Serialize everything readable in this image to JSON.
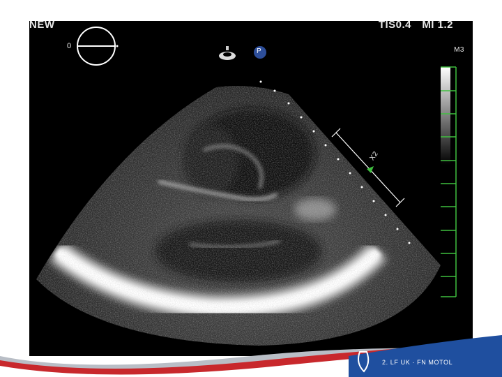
{
  "header": {
    "mode": "NEW",
    "tis": "TIS0.4",
    "mi": "MI 1.2",
    "probe_angle": "0",
    "marker": "P",
    "scale_name": "M3"
  },
  "caliper": {
    "label": "X2"
  },
  "footer": {
    "logo_line1": "",
    "logo_line2": "2. LF UK · FN MOTOL",
    "colors": {
      "red_swoosh": "#c8282c",
      "blue_swoosh": "#1f4f9f",
      "gray_swoosh": "#b9bec6"
    }
  },
  "colors": {
    "screen_bg": "#000000",
    "overlay_text": "#e8e8e8",
    "scale_ticks": "#3fbf3f",
    "marker_bg": "#2d4e9a"
  }
}
